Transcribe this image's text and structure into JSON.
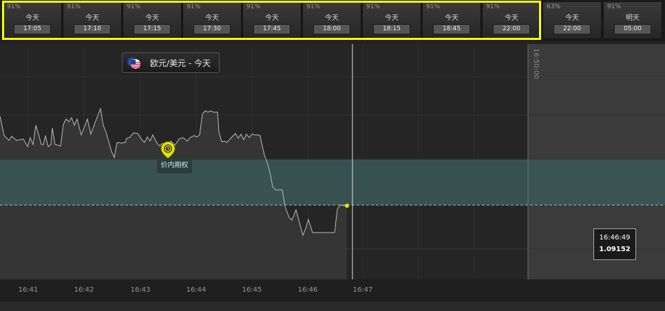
{
  "expiry_tiles": [
    {
      "pct": "91%",
      "day": "今天",
      "time": "17:05"
    },
    {
      "pct": "91%",
      "day": "今天",
      "time": "17:10"
    },
    {
      "pct": "91%",
      "day": "今天",
      "time": "17:15"
    },
    {
      "pct": "91%",
      "day": "今天",
      "time": "17:30"
    },
    {
      "pct": "91%",
      "day": "今天",
      "time": "17:45"
    },
    {
      "pct": "91%",
      "day": "今天",
      "time": "18:00"
    },
    {
      "pct": "91%",
      "day": "今天",
      "time": "18:15"
    },
    {
      "pct": "91%",
      "day": "今天",
      "time": "18:45"
    },
    {
      "pct": "91%",
      "day": "今天",
      "time": "22:00"
    },
    {
      "pct": "63%",
      "day": "今天",
      "time": "22:00"
    },
    {
      "pct": "91%",
      "day": "明天",
      "time": "05:00"
    }
  ],
  "asset": {
    "label": "欧元/美元 - 今天",
    "flag_icon": "eur-usd-flag-icon"
  },
  "itm_marker": {
    "label": "价内期权",
    "icon": "location-pin-clock-icon"
  },
  "readout": {
    "time": "16:46:49",
    "value": "1.09152"
  },
  "expiry_line_label": "16:50:00",
  "x_axis_ticks": [
    "16:41",
    "16:42",
    "16:43",
    "16:44",
    "16:45",
    "16:46",
    "16:47"
  ],
  "colors": {
    "highlight": "#ffff00",
    "in_money_band": "#3a5858",
    "price_line": "#bdbdbd",
    "marker": "#e6e600"
  }
}
